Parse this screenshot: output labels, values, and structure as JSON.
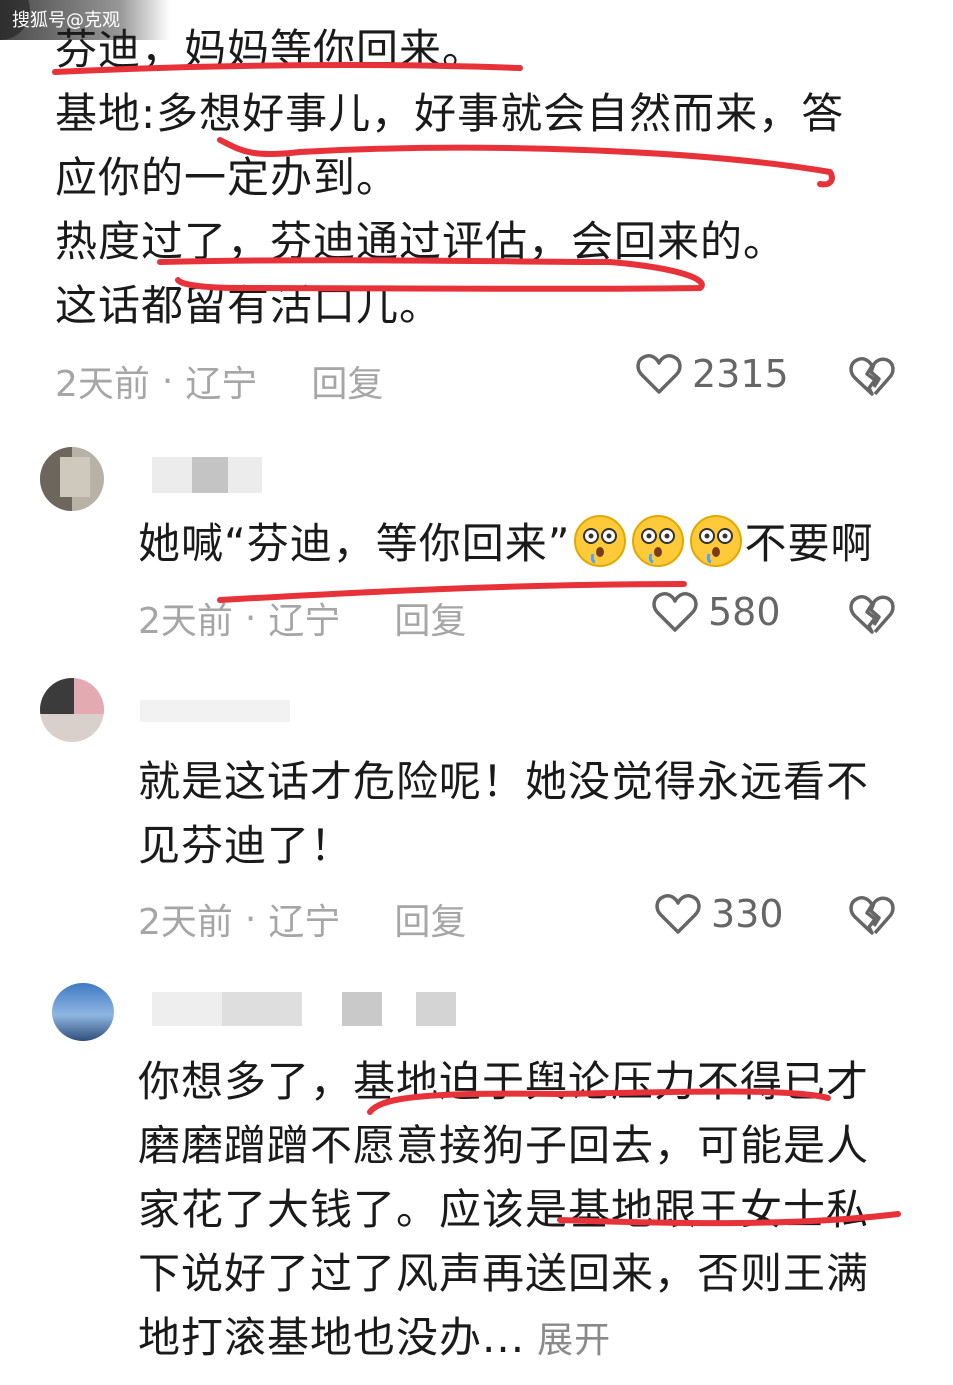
{
  "watermark": "搜狐号@克观",
  "comments": [
    {
      "lines": [
        "芬迪，妈妈等你回来。",
        "基地:多想好事儿，好事就会自然而来，答",
        "应你的一定办到。",
        "热度过了，芬迪通过评估，会回来的。",
        "这话都留有活口儿。"
      ],
      "time": "2天前",
      "dot": "·",
      "location": "辽宁",
      "reply": "回复",
      "likes": "2315"
    },
    {
      "text_before": "她喊“芬迪，等你回来”",
      "text_after": "不要啊",
      "time": "2天前",
      "dot": "·",
      "location": "辽宁",
      "reply": "回复",
      "likes": "580"
    },
    {
      "lines": [
        "就是这话才危险呢！她没觉得永远看不",
        "见芬迪了！"
      ],
      "time": "2天前",
      "dot": "·",
      "location": "辽宁",
      "reply": "回复",
      "likes": "330"
    },
    {
      "lines": [
        "你想多了，基地迫于舆论压力不得已才",
        "磨磨蹭蹭不愿意接狗子回去，可能是人",
        "家花了大钱了。应该是基地跟王女士私",
        "下说好了过了风声再送回来，否则王满"
      ],
      "last_line": "地打滚基地也没办...",
      "expand": "展开"
    }
  ],
  "icons": {
    "like": "heart-outline-icon",
    "dislike": "broken-heart-icon",
    "emoji": "crying-face-emoji"
  },
  "colors": {
    "annotation": "#e8323a",
    "meta": "#a6a6a6"
  }
}
